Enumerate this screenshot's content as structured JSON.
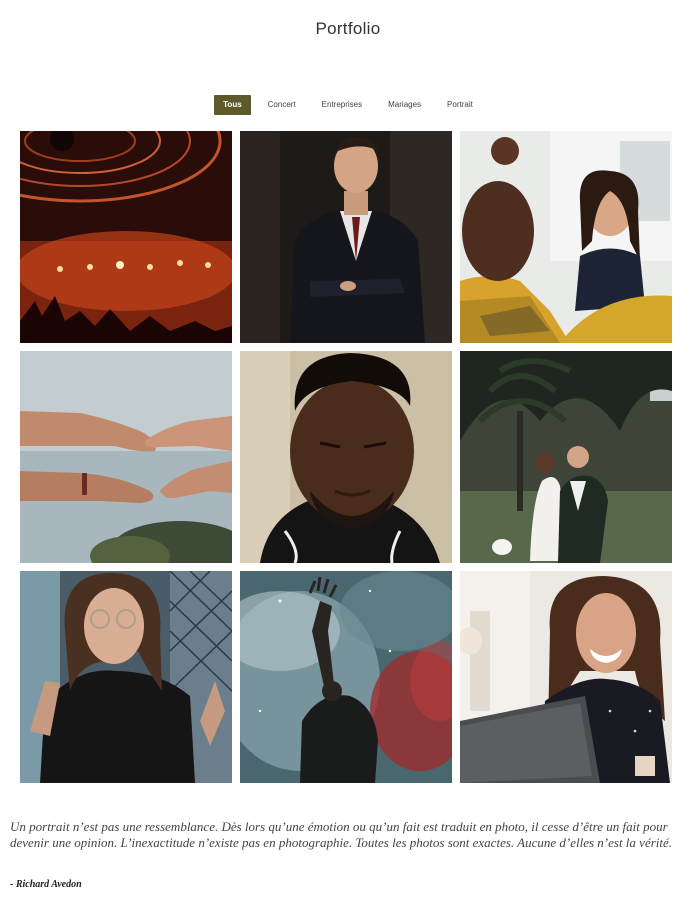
{
  "page": {
    "title": "Portfolio"
  },
  "filters": [
    {
      "label": "Tous",
      "active": true
    },
    {
      "label": "Concert",
      "active": false
    },
    {
      "label": "Entreprises",
      "active": false
    },
    {
      "label": "Mariages",
      "active": false
    },
    {
      "label": "Portrait",
      "active": false
    }
  ],
  "gallery": [
    {
      "subject": "concert-stage-lights"
    },
    {
      "subject": "businessman-portrait"
    },
    {
      "subject": "office-meeting-smiling-woman"
    },
    {
      "subject": "reaching-hands"
    },
    {
      "subject": "man-close-portrait"
    },
    {
      "subject": "wedding-couple-palms"
    },
    {
      "subject": "woman-glasses-portrait"
    },
    {
      "subject": "performer-smoke"
    },
    {
      "subject": "laughing-woman-laptop"
    }
  ],
  "quote": {
    "text": "Un portrait n’est pas une ressemblance. Dès lors qu’une émotion ou qu’un fait est traduit en photo, il cesse d’être un fait pour devenir une opinion. L’inexactitude n’existe pas en photographie. Toutes les photos sont exactes. Aucune d’elles n’est la vérité.",
    "author": "- Richard Avedon"
  },
  "colors": {
    "accent": "#5e5a2a"
  }
}
